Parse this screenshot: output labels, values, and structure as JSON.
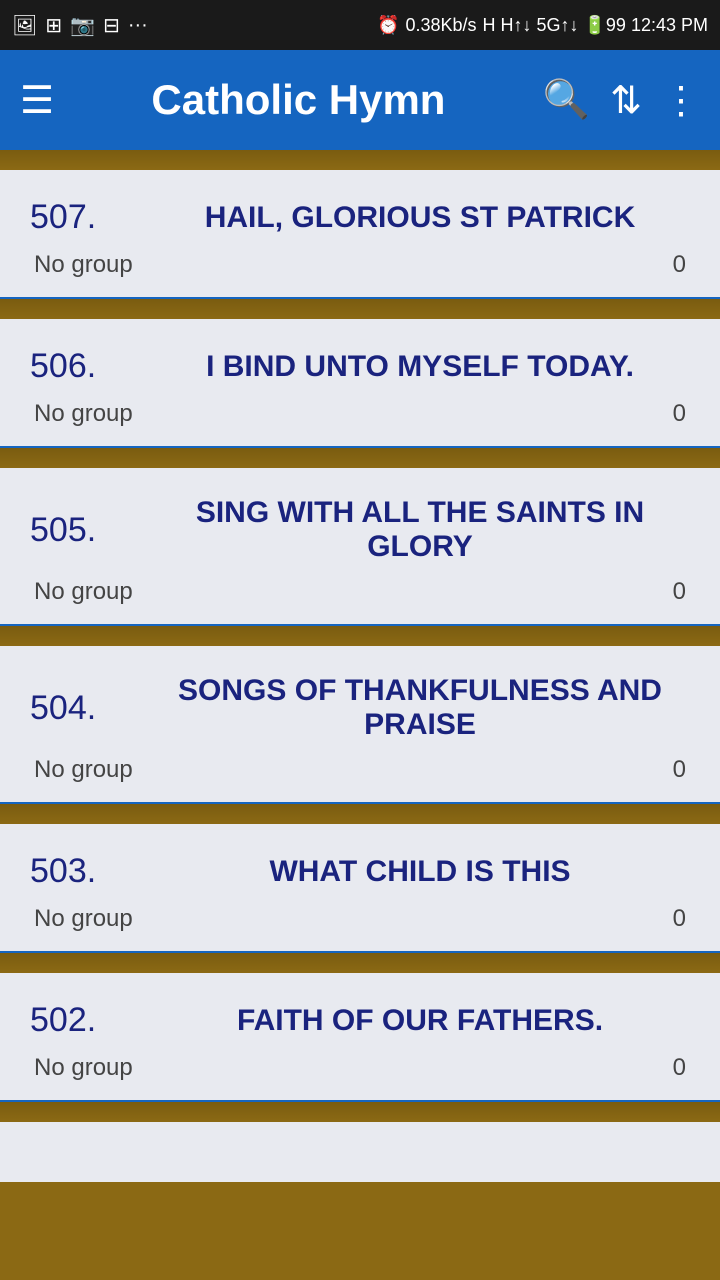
{
  "statusBar": {
    "leftIcons": [
      "🖼",
      "⚏",
      "📷",
      "⊞",
      "···"
    ],
    "centerText": "0.38Kb/s",
    "rightIcons": "H H↑↓ 5G↑↓ 99 12:43 PM"
  },
  "header": {
    "title": "Catholic Hymn",
    "menuIcon": "☰",
    "searchIcon": "🔍",
    "sortIcon": "⇅",
    "moreIcon": "⋮"
  },
  "hymns": [
    {
      "number": "507.",
      "title": "HAIL, GLORIOUS ST PATRICK",
      "group": "No group",
      "count": "0"
    },
    {
      "number": "506.",
      "title": "I BIND UNTO MYSELF TODAY.",
      "group": "No group",
      "count": "0"
    },
    {
      "number": "505.",
      "title": "SING WITH ALL THE SAINTS IN GLORY",
      "group": "No group",
      "count": "0"
    },
    {
      "number": "504.",
      "title": "SONGS OF THANKFULNESS AND PRAISE",
      "group": "No group",
      "count": "0"
    },
    {
      "number": "503.",
      "title": "WHAT CHILD IS THIS",
      "group": "No group",
      "count": "0"
    },
    {
      "number": "502.",
      "title": "FAITH OF OUR FATHERS.",
      "group": "No group",
      "count": "0"
    }
  ],
  "labels": {
    "no_group": "No group"
  }
}
